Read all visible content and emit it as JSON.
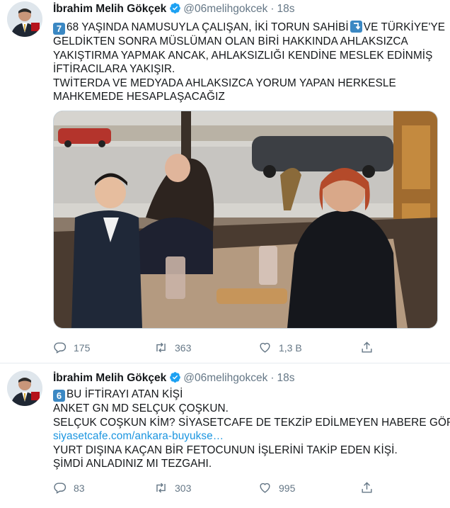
{
  "tweets": [
    {
      "name": "İbrahim Melih Gökçek",
      "handle": "@06melihgokcek",
      "separator": "·",
      "time": "18s",
      "lines": [
        {
          "pre": "7",
          "text": "68 YAŞINDA NAMUSUYLA ÇALIŞAN, İKİ TORUN SAHİBİ",
          "post": "VE TÜRKİYE'YE"
        },
        {
          "text": "GELDİKTEN SONRA MÜSLÜMAN OLAN BİRİ HAKKINDA AHLAKSIZCA"
        },
        {
          "text": "YAKIŞTIRMA YAPMAK ANCAK, AHLAKSIZLIĞI KENDİNE MESLEK EDİNMİŞ"
        },
        {
          "text": "İFTİRACILARA YAKIŞIR."
        },
        {
          "text": "TWİTERDA VE MEDYADA AHLAKSIZCA YORUM YAPAN HERKESLE"
        },
        {
          "text": "MAHKEMEDE HESAPLAŞACAĞIZ"
        }
      ],
      "stats": {
        "replies": "175",
        "retweets": "363",
        "likes": "1,3 B"
      }
    },
    {
      "name": "İbrahim Melih Gökçek",
      "handle": "@06melihgokcek",
      "separator": "·",
      "time": "18s",
      "lines": [
        {
          "pre": "6",
          "text": "BU İFTİRAYI ATAN KİŞİ"
        },
        {
          "text": "ANKET GN MD SELÇUK ÇOŞKUN."
        },
        {
          "text": "SELÇUK COŞKUN KİM? SİYASETCAFE DE  TEKZİP EDİLMEYEN HABERE GÖRE"
        },
        {
          "link": "siyasetcafe.com/ankara-buyukse…"
        },
        {
          "text": "YURT DIŞINA KAÇAN BİR FETOCUNUN İŞLERİNİ TAKİP EDEN KİŞİ."
        },
        {
          "text": "ŞİMDİ  ANLADINIZ MI TEZGAHI."
        }
      ],
      "stats": {
        "replies": "83",
        "retweets": "303",
        "likes": "995"
      }
    }
  ],
  "colors": {
    "accent": "#1da1f2",
    "link": "#1b95e0",
    "muted": "#657786",
    "emoji_key": "#3b88c3"
  },
  "icons": [
    "verified-badge-icon",
    "reply-icon",
    "retweet-icon",
    "like-icon",
    "share-icon",
    "keycap-emoji",
    "arrow-emoji"
  ]
}
